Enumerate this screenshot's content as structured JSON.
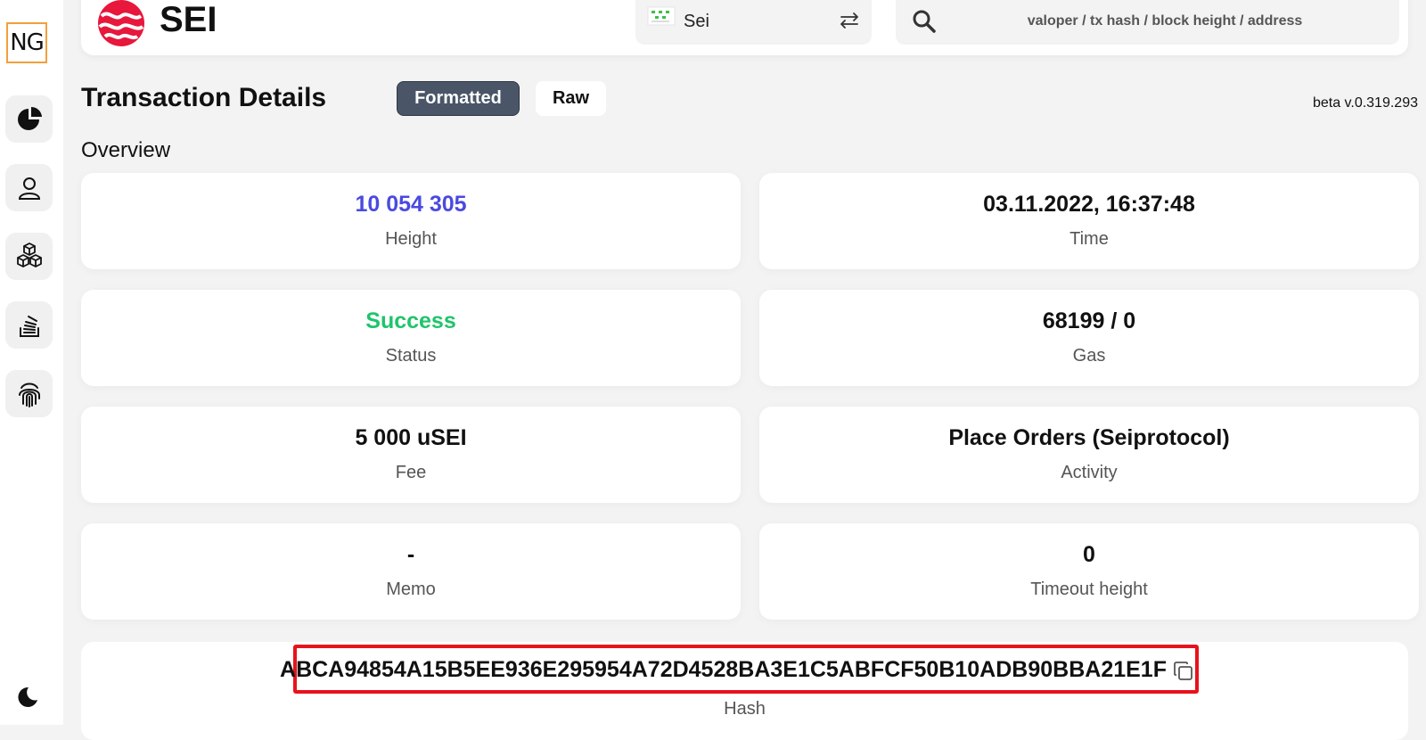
{
  "sidebar": {
    "logo_text": "NG",
    "items": [
      {
        "icon": "pie-chart-icon"
      },
      {
        "icon": "user-icon"
      },
      {
        "icon": "blocks-icon"
      },
      {
        "icon": "stack-icon"
      },
      {
        "icon": "fingerprint-icon"
      }
    ],
    "theme_icon": "moon-icon"
  },
  "header": {
    "brand": "SEI",
    "chain": "Sei",
    "search_placeholder": "valoper / tx hash / block height / address"
  },
  "page": {
    "title": "Transaction Details",
    "tabs": [
      "Formatted",
      "Raw"
    ],
    "active_tab": "Formatted",
    "version": "beta v.0.319.293",
    "section": "Overview"
  },
  "overview": [
    {
      "value": "10 054 305",
      "label": "Height",
      "color": "#4a4ae0"
    },
    {
      "value": "03.11.2022, 16:37:48",
      "label": "Time",
      "color": "#111111"
    },
    {
      "value": "Success",
      "label": "Status",
      "color": "#1fc46b"
    },
    {
      "value": "68199 / 0",
      "label": "Gas",
      "color": "#111111"
    },
    {
      "value": "5 000 uSEI",
      "label": "Fee",
      "color": "#111111"
    },
    {
      "value": "Place Orders (Seiprotocol)",
      "label": "Activity",
      "color": "#111111"
    },
    {
      "value": "-",
      "label": "Memo",
      "color": "#111111"
    },
    {
      "value": "0",
      "label": "Timeout height",
      "color": "#111111"
    }
  ],
  "hash": {
    "value": "ABCA94854A15B5EE936E295954A72D4528BA3E1C5ABFCF50B10ADB90BBA21E1F",
    "label": "Hash",
    "highlight_color": "#e8121b"
  }
}
